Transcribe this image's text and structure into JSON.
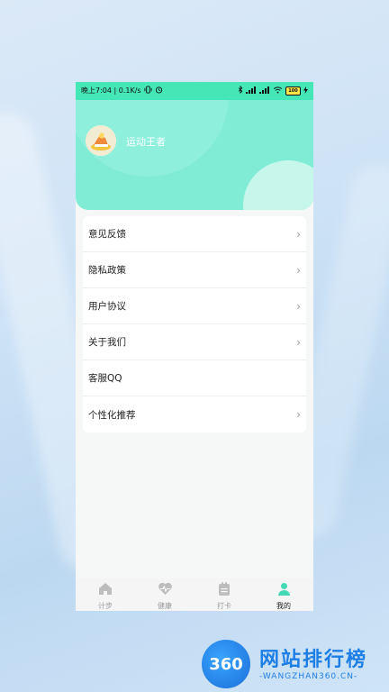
{
  "status_bar": {
    "time_text": "晚上7:04 | 0.1K/s",
    "battery": "100"
  },
  "profile": {
    "username": "运动王者"
  },
  "menu": [
    {
      "label": "意见反馈",
      "chevron": true
    },
    {
      "label": "隐私政策",
      "chevron": true
    },
    {
      "label": "用户协议",
      "chevron": true
    },
    {
      "label": "关于我们",
      "chevron": true
    },
    {
      "label": "客服QQ",
      "chevron": false
    },
    {
      "label": "个性化推荐",
      "chevron": true
    }
  ],
  "tabs": [
    {
      "label": "计步",
      "icon": "home-icon",
      "active": false
    },
    {
      "label": "健康",
      "icon": "heart-pulse-icon",
      "active": false
    },
    {
      "label": "打卡",
      "icon": "checkin-clipboard-icon",
      "active": false
    },
    {
      "label": "我的",
      "icon": "user-icon",
      "active": true
    }
  ],
  "watermark": {
    "badge": "360",
    "title": "网站排行榜",
    "subtitle": "-WANGZHAN360.CN-"
  },
  "colors": {
    "accent": "#45e7b7",
    "header_bg": "#80ecd6",
    "tab_active": "#45d8b5",
    "tab_inactive": "#b8b8b8"
  }
}
